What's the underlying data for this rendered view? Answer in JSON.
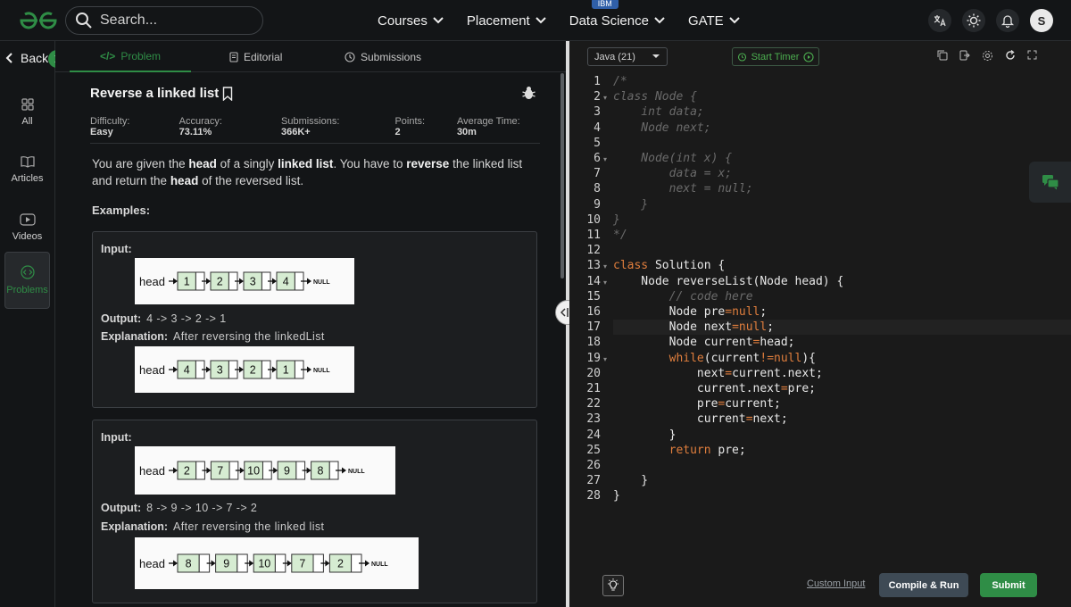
{
  "header": {
    "search_placeholder": "Search...",
    "nav": [
      {
        "label": "Courses"
      },
      {
        "label": "Placement"
      },
      {
        "label": "Data Science",
        "badge": "IBM"
      },
      {
        "label": "GATE"
      }
    ],
    "avatar_initial": "S"
  },
  "sidebar": {
    "back_label": "Back",
    "items": [
      {
        "label": "All",
        "icon": "grid-icon"
      },
      {
        "label": "Articles",
        "icon": "book-icon"
      },
      {
        "label": "Videos",
        "icon": "video-icon"
      },
      {
        "label": "Problems",
        "icon": "code-icon",
        "active": true
      }
    ]
  },
  "tabs": [
    {
      "label": "Problem",
      "active": true
    },
    {
      "label": "Editorial"
    },
    {
      "label": "Submissions"
    }
  ],
  "problem": {
    "title": "Reverse a linked list",
    "meta": {
      "difficulty_label": "Difficulty:",
      "difficulty": "Easy",
      "accuracy_label": "Accuracy:",
      "accuracy": "73.11%",
      "submissions_label": "Submissions:",
      "submissions": "366K+",
      "points_label": "Points:",
      "points": "2",
      "time_label": "Average Time:",
      "time": "30m"
    },
    "desc": {
      "p1": "You are given the ",
      "b1": "head",
      "p2": " of a singly ",
      "b2": "linked list",
      "p3": ". You have to ",
      "b3": "reverse",
      "p4": " the linked list and return the ",
      "b4": "head",
      "p5": " of the reversed list."
    },
    "examples_label": "Examples:",
    "examples": [
      {
        "input_label": "Input:",
        "input_list": [
          "1",
          "2",
          "3",
          "4"
        ],
        "output_label": "Output:",
        "output": "4 -> 3 -> 2 -> 1",
        "explanation_label": "Explanation:",
        "explanation": "After reversing the linkedList",
        "output_list": [
          "4",
          "3",
          "2",
          "1"
        ]
      },
      {
        "input_label": "Input:",
        "input_list": [
          "2",
          "7",
          "10",
          "9",
          "8"
        ],
        "output_label": "Output:",
        "output": "8 -> 9 -> 10 -> 7 -> 2",
        "explanation_label": "Explanation:",
        "explanation": "After reversing the linked list",
        "output_list": [
          "8",
          "9",
          "10",
          "7",
          "2"
        ]
      }
    ],
    "diagram_head": "head",
    "diagram_null": "NULL"
  },
  "editor": {
    "language": "Java (21)",
    "timer_label": "Start Timer",
    "lines": [
      [
        [
          "cm",
          "/*"
        ]
      ],
      [
        [
          "cm",
          "class Node {"
        ]
      ],
      [
        [
          "cm",
          "    int data;"
        ]
      ],
      [
        [
          "cm",
          "    Node next;"
        ]
      ],
      [
        [
          "cm",
          ""
        ]
      ],
      [
        [
          "cm",
          "    Node(int x) {"
        ]
      ],
      [
        [
          "cm",
          "        data = x;"
        ]
      ],
      [
        [
          "cm",
          "        next = null;"
        ]
      ],
      [
        [
          "cm",
          "    }"
        ]
      ],
      [
        [
          "cm",
          "}"
        ]
      ],
      [
        [
          "cm",
          "*/"
        ]
      ],
      [
        [
          "tx",
          ""
        ]
      ],
      [
        [
          "kw",
          "class"
        ],
        [
          "tx",
          " Solution {"
        ]
      ],
      [
        [
          "tx",
          "    Node reverseList(Node head) {"
        ]
      ],
      [
        [
          "cm",
          "        // code here"
        ]
      ],
      [
        [
          "tx",
          "        Node pre"
        ],
        [
          "kw",
          "="
        ],
        [
          "kw",
          "null"
        ],
        [
          "tx",
          ";"
        ]
      ],
      [
        [
          "tx",
          "        Node next"
        ],
        [
          "kw",
          "="
        ],
        [
          "kw",
          "null"
        ],
        [
          "tx",
          ";"
        ]
      ],
      [
        [
          "tx",
          "        Node current"
        ],
        [
          "kw",
          "="
        ],
        [
          "tx",
          "head;"
        ]
      ],
      [
        [
          "kw",
          "        while"
        ],
        [
          "tx",
          "(current"
        ],
        [
          "kw",
          "!="
        ],
        [
          "kw",
          "null"
        ],
        [
          "tx",
          "){"
        ]
      ],
      [
        [
          "tx",
          "            next"
        ],
        [
          "kw",
          "="
        ],
        [
          "tx",
          "current.next;"
        ]
      ],
      [
        [
          "tx",
          "            current.next"
        ],
        [
          "kw",
          "="
        ],
        [
          "tx",
          "pre;"
        ]
      ],
      [
        [
          "tx",
          "            pre"
        ],
        [
          "kw",
          "="
        ],
        [
          "tx",
          "current;"
        ]
      ],
      [
        [
          "tx",
          "            current"
        ],
        [
          "kw",
          "="
        ],
        [
          "tx",
          "next;"
        ]
      ],
      [
        [
          "tx",
          "        }"
        ]
      ],
      [
        [
          "kw",
          "        return"
        ],
        [
          "tx",
          " pre;"
        ]
      ],
      [
        [
          "tx",
          ""
        ]
      ],
      [
        [
          "tx",
          "    }"
        ]
      ],
      [
        [
          "tx",
          "}"
        ]
      ]
    ],
    "fold_lines": [
      2,
      6,
      13,
      14,
      19
    ],
    "highlight_line": 17,
    "custom_input_label": "Custom Input",
    "run_label": "Compile & Run",
    "submit_label": "Submit"
  },
  "colors": {
    "accent": "#2f8d46",
    "keyword": "#e07e3d",
    "comment": "#6a6a6a"
  }
}
